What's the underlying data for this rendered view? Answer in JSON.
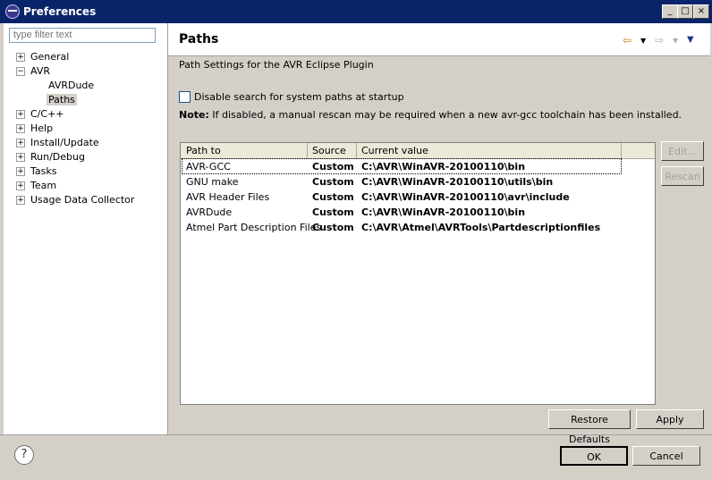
{
  "window": {
    "title": "Preferences"
  },
  "filter": {
    "placeholder": "type filter text"
  },
  "tree": {
    "items": [
      "General",
      "AVR",
      "AVRDude",
      "Paths",
      "C/C++",
      "Help",
      "Install/Update",
      "Run/Debug",
      "Tasks",
      "Team",
      "Usage Data Collector"
    ]
  },
  "header": {
    "title": "Paths"
  },
  "content": {
    "description": "Path Settings for the AVR Eclipse Plugin",
    "checkbox_label": "Disable search for system paths at startup",
    "note_bold": "Note:",
    "note_text": " If disabled, a manual rescan may be required when a new avr-gcc toolchain has been installed."
  },
  "table": {
    "headers": [
      "Path to",
      "Source",
      "Current value"
    ],
    "rows": [
      {
        "path": "AVR-GCC",
        "source": "Custom",
        "value": "C:\\AVR\\WinAVR-20100110\\bin"
      },
      {
        "path": "GNU make",
        "source": "Custom",
        "value": "C:\\AVR\\WinAVR-20100110\\utils\\bin"
      },
      {
        "path": "AVR Header Files",
        "source": "Custom",
        "value": "C:\\AVR\\WinAVR-20100110\\avr\\include"
      },
      {
        "path": "AVRDude",
        "source": "Custom",
        "value": "C:\\AVR\\WinAVR-20100110\\bin"
      },
      {
        "path": "Atmel Part Description Files",
        "source": "Custom",
        "value": "C:\\AVR\\Atmel\\AVRTools\\Partdescriptionfiles"
      }
    ]
  },
  "buttons": {
    "edit": "Edit...",
    "rescan": "Rescan",
    "restore_defaults": "Restore Defaults",
    "apply": "Apply",
    "ok": "OK",
    "cancel": "Cancel"
  }
}
